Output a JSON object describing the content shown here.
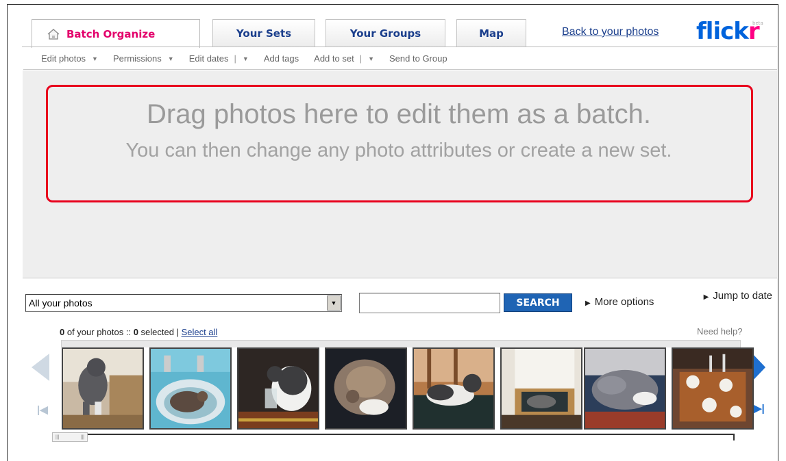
{
  "tabs": [
    {
      "label": "Batch Organize",
      "active": true
    },
    {
      "label": "Your Sets",
      "active": false
    },
    {
      "label": "Your Groups",
      "active": false
    },
    {
      "label": "Map",
      "active": false
    }
  ],
  "header": {
    "back_link": "Back to your photos",
    "logo_part1": "flick",
    "logo_part2": "r",
    "logo_badge": "beta"
  },
  "menu": {
    "edit_photos": "Edit photos",
    "permissions": "Permissions",
    "edit_dates": "Edit dates",
    "add_tags": "Add tags",
    "add_to_set": "Add to set",
    "send_to_group": "Send to Group"
  },
  "dropzone": {
    "main": "Drag photos here to edit them as a batch.",
    "sub": "You can then change any photo attributes or create a new set."
  },
  "filter": {
    "selected": "All your photos"
  },
  "search": {
    "value": "",
    "button_label": "SEARCH"
  },
  "more_options": "More options",
  "jump_to_date": "Jump to date",
  "status": {
    "count": "0",
    "count_text": " of your photos :: ",
    "selected": "0",
    "selected_text": " selected | ",
    "select_all": "Select all"
  },
  "need_help": "Need help?",
  "thumbnails": [
    "cat on chair",
    "cat in sink",
    "cat drinking from glass",
    "curled cat",
    "cats on sofa",
    "cat on chair",
    "cat sleeping on blanket",
    "dinner table"
  ],
  "colors": {
    "active_tab": "#e3006b",
    "link": "#1a3e8c",
    "search_button": "#1f64b4",
    "highlight": "#e8001c",
    "flickr_blue": "#0063dc",
    "flickr_pink": "#ff0084"
  }
}
